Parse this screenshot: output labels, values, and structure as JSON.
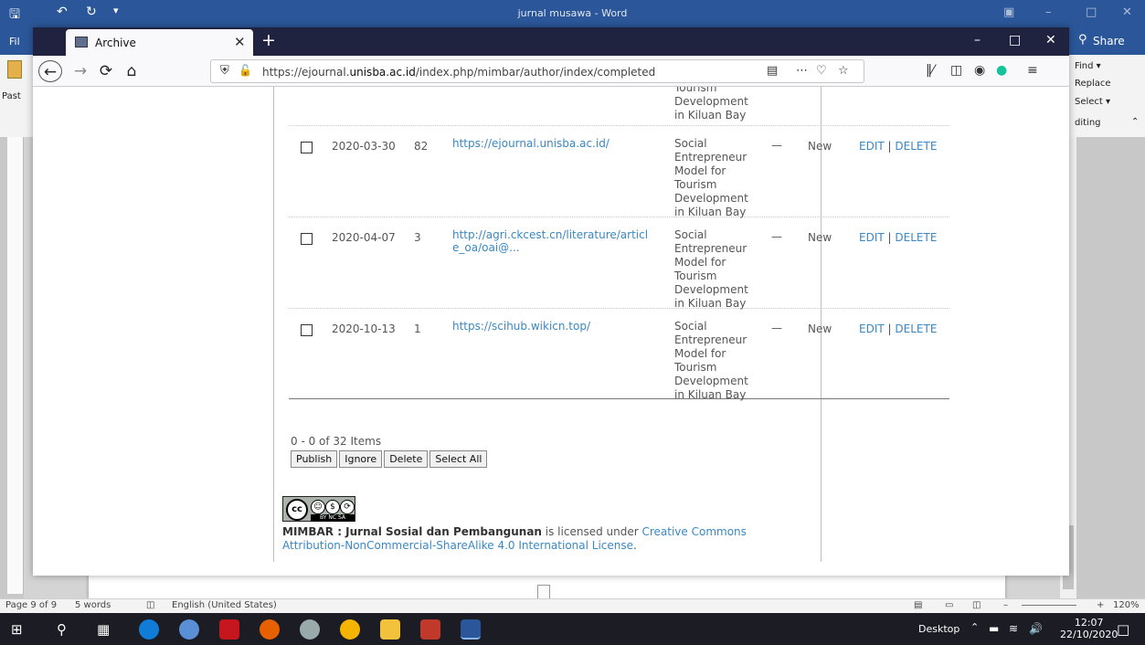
{
  "word": {
    "title": "jurnal musawa - Word",
    "share": "Share",
    "file_tab": "Fil",
    "paste": "Past",
    "find": "Find",
    "replace": "Replace",
    "select": "Select",
    "editing": "diting",
    "status": {
      "page": "Page 9 of 9",
      "words": "5 words",
      "language": "English (United States)",
      "zoom": "120%"
    }
  },
  "browser": {
    "tab_title": "Archive",
    "url_prefix": "https://ejournal.",
    "url_domain": "unisba.ac.id",
    "url_path": "/index.php/mimbar/author/index/completed"
  },
  "page": {
    "top_title": "Tourism Development in Kiluan Bay",
    "rows": [
      {
        "date": "2020-03-30",
        "count": "82",
        "url": "https://ejournal.unisba.ac.id/",
        "title": "Social Entrepreneur Model for Tourism Development in Kiluan Bay",
        "dash": "—",
        "status": "New",
        "edit": "EDIT",
        "sep": "|",
        "delete": "DELETE"
      },
      {
        "date": "2020-04-07",
        "count": "3",
        "url": "http://agri.ckcest.cn/literature/article_oa/oai@...",
        "title": "Social Entrepreneur Model for Tourism Development in Kiluan Bay",
        "dash": "—",
        "status": "New",
        "edit": "EDIT",
        "sep": "|",
        "delete": "DELETE"
      },
      {
        "date": "2020-10-13",
        "count": "1",
        "url": "https://scihub.wikicn.top/",
        "title": "Social Entrepreneur Model for Tourism Development in Kiluan Bay",
        "dash": "—",
        "status": "New",
        "edit": "EDIT",
        "sep": "|",
        "delete": "DELETE"
      }
    ],
    "items_text": "0 - 0 of 32 Items",
    "buttons": {
      "publish": "Publish",
      "ignore": "Ignore",
      "delete": "Delete",
      "select_all": "Select All"
    },
    "cc_label": "BY NC SA",
    "license_journal": "MIMBAR : Jurnal Sosial dan Pembangunan",
    "license_mid": " is licensed under ",
    "license_link": "Creative Commons Attribution-NonCommercial-ShareAlike 4.0 International License",
    "license_end": "."
  },
  "taskbar": {
    "desktop": "Desktop",
    "time": "12:07",
    "date": "22/10/2020"
  }
}
